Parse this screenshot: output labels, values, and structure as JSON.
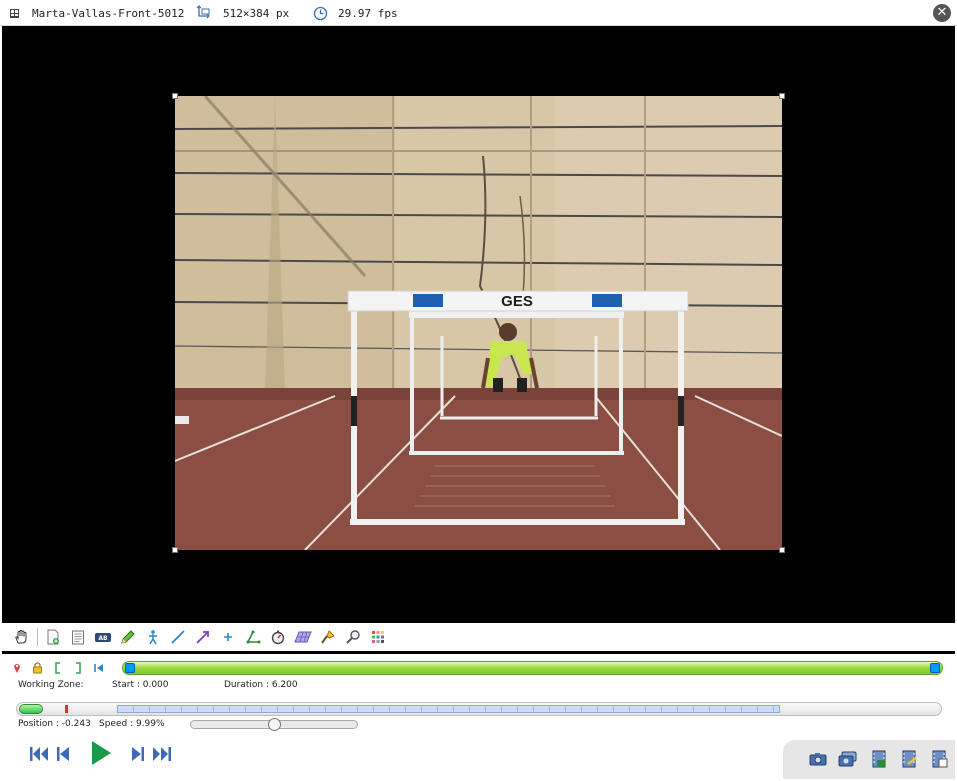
{
  "infobar": {
    "filename": "Marta-Vallas-Front-5012",
    "resolution": "512×384 px",
    "framerate": "29.97 fps"
  },
  "video": {
    "hurdle_text": "GES"
  },
  "working_zone": {
    "label": "Working Zone:",
    "start": "Start : 0.000",
    "duration": "Duration : 6.200"
  },
  "playback": {
    "position": "Position : -0.243",
    "speed": "Speed : 9.99%",
    "speed_fraction": 0.5,
    "position_fraction": 0.03
  },
  "icons": {
    "toolbar": [
      "hand-icon",
      "add-keyframe-icon",
      "comment-icon",
      "label-icon",
      "pencil-icon",
      "human-model-icon",
      "line-icon",
      "arrow-icon",
      "cross-marker-icon",
      "angle-icon",
      "chrono-icon",
      "grid-plane-icon",
      "spotlight-icon",
      "magnifier-icon",
      "color-profile-icon"
    ],
    "export": [
      "snapshot-icon",
      "multi-snapshot-icon",
      "save-video-icon",
      "export-video-icon",
      "export-frames-icon"
    ]
  },
  "colors": {
    "working_zone": "#9bd93d",
    "zone_handle": "#0099ff",
    "play": "#1a9a4a",
    "nav": "#3d6bb3"
  }
}
